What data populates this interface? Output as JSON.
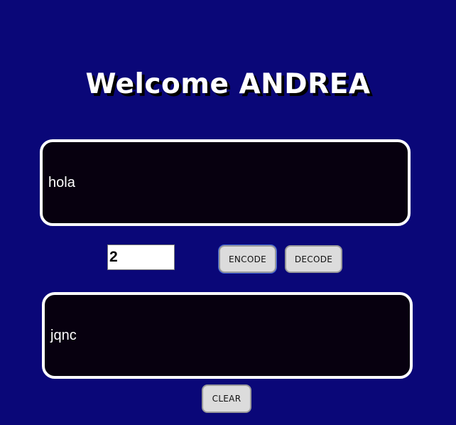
{
  "header": {
    "title": "Welcome ANDREA"
  },
  "input_area": {
    "text": "hola"
  },
  "controls": {
    "shift_value": "2",
    "encode_label": "ENCODE",
    "decode_label": "DECODE"
  },
  "output_area": {
    "text": "jqnc"
  },
  "footer": {
    "clear_label": "CLEAR"
  },
  "colors": {
    "background": "#0a0778",
    "textbox_background": "#07000f",
    "textbox_border": "#ffffff",
    "button_background": "#dcdcdc",
    "focus_outline": "#3b5fd6"
  }
}
